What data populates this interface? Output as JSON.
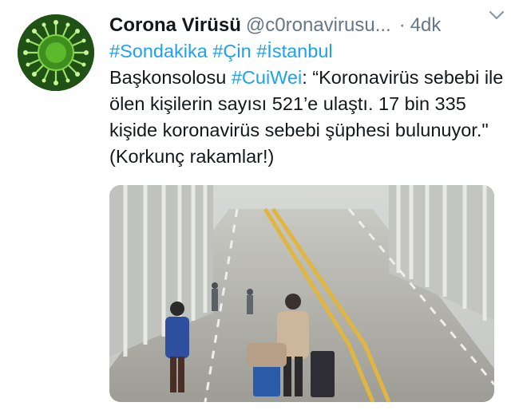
{
  "tweet": {
    "author_name": "Corona Virüsü",
    "author_handle": "@c0ronavirusu...",
    "separator": "·",
    "time": "4dk",
    "hashtags": [
      "#Sondakika",
      "#Çin",
      "#İstanbul"
    ],
    "line_prefix": "Başkonsolosu ",
    "mention_tag": "#CuiWei",
    "body_text": ": “Koronavirüs sebebi ile ölen kişilerin sayısı 521’e ulaştı. 17 bin 335 kişide koronavirüs sebebi şüphesi bulunuyor.\" (Korkunç rakamlar!)"
  },
  "icons": {
    "avatar": "virus-avatar",
    "menu": "chevron-down-icon"
  },
  "colors": {
    "link": "#1da1f2",
    "text": "#14171a",
    "secondary": "#657786"
  }
}
